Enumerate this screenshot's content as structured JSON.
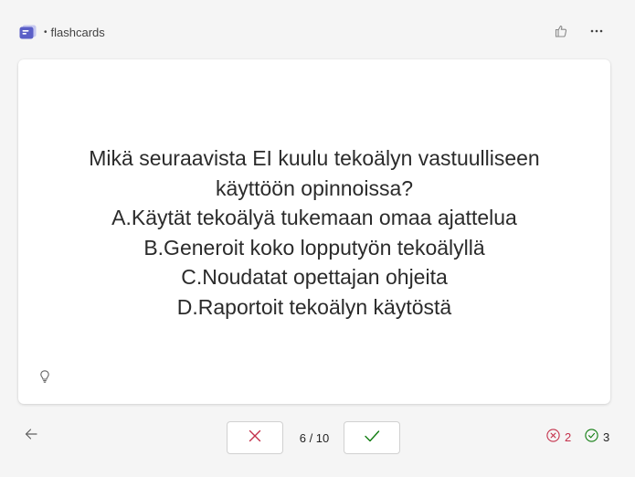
{
  "header": {
    "app_icon": "flashcards-app-icon",
    "dot": "•",
    "title": "flashcards",
    "feedback_icon": "thumb-icon",
    "more_icon": "more-horizontal-icon"
  },
  "card": {
    "question_lines": [
      "Mikä seuraavista EI kuulu tekoälyn vastuulliseen",
      "käyttöön opinnoissa?",
      "A.Käytät tekoälyä tukemaan omaa ajattelua",
      "B.Generoit koko lopputyön tekoälyllä",
      "C.Noudatat opettajan ohjeita",
      "D.Raportoit tekoälyn käytöstä"
    ],
    "hint_icon": "lightbulb-icon"
  },
  "footer": {
    "back_icon": "arrow-left-icon",
    "wrong_icon": "x-icon",
    "right_icon": "check-icon",
    "counter": "6 / 10",
    "wrong_count": "2",
    "right_count": "3"
  },
  "colors": {
    "accent": "#5b5fc7",
    "wrong": "#c4314b",
    "right": "#107c10",
    "background": "#f5f5f5"
  }
}
